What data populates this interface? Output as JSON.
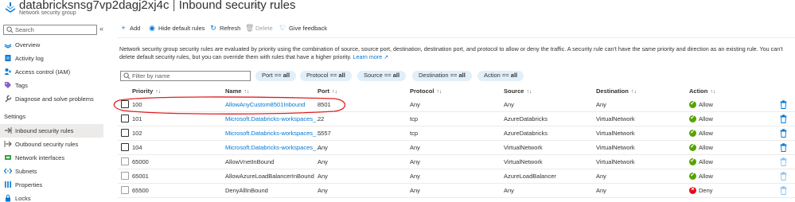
{
  "header": {
    "resource_name": "databricksnsg7vp2dagj2xj4c",
    "page_name": "Inbound security rules",
    "separator": "|",
    "resource_type": "Network security group",
    "star_glyph": "☆",
    "more_glyph": "···"
  },
  "sidebar": {
    "search_placeholder": "Search",
    "collapse_glyph": "«",
    "items_top": [
      {
        "label": "Overview",
        "icon": "overview-icon"
      },
      {
        "label": "Activity log",
        "icon": "activity-log-icon"
      },
      {
        "label": "Access control (IAM)",
        "icon": "iam-icon"
      },
      {
        "label": "Tags",
        "icon": "tag-icon"
      },
      {
        "label": "Diagnose and solve problems",
        "icon": "wrench-icon"
      }
    ],
    "section_settings": "Settings",
    "items_settings": [
      {
        "label": "Inbound security rules",
        "icon": "inbound-icon",
        "active": true
      },
      {
        "label": "Outbound security rules",
        "icon": "outbound-icon"
      },
      {
        "label": "Network interfaces",
        "icon": "nic-icon"
      },
      {
        "label": "Subnets",
        "icon": "subnet-icon"
      },
      {
        "label": "Properties",
        "icon": "properties-icon"
      },
      {
        "label": "Locks",
        "icon": "lock-icon"
      }
    ]
  },
  "toolbar": {
    "add": "Add",
    "hide_default": "Hide default rules",
    "refresh": "Refresh",
    "delete": "Delete",
    "feedback": "Give feedback"
  },
  "description": {
    "text": "Network security group security rules are evaluated by priority using the combination of source, source port, destination, destination port, and protocol to allow or deny the traffic. A security rule can't have the same priority and direction as an existing rule. You can't delete default security rules, but you can override them with rules that have a higher priority.",
    "learn_more": "Learn more"
  },
  "filters": {
    "name_placeholder": "Filter by name",
    "pills": [
      {
        "label": "Port == ",
        "value": "all"
      },
      {
        "label": "Protocol == ",
        "value": "all"
      },
      {
        "label": "Source == ",
        "value": "all"
      },
      {
        "label": "Destination == ",
        "value": "all"
      },
      {
        "label": "Action == ",
        "value": "all"
      }
    ]
  },
  "table": {
    "columns": [
      "Priority",
      "Name",
      "Port",
      "Protocol",
      "Source",
      "Destination",
      "Action"
    ],
    "sort_glyph": "↑↓",
    "rows": [
      {
        "priority": "100",
        "name": "AllowAnyCustom8501Inbound",
        "port": "8501",
        "protocol": "Any",
        "source": "Any",
        "destination": "Any",
        "action": "Allow",
        "default": false
      },
      {
        "priority": "101",
        "name": "Microsoft.Databricks-workspaces_...",
        "port": "22",
        "protocol": "tcp",
        "source": "AzureDatabricks",
        "destination": "VirtualNetwork",
        "action": "Allow",
        "default": false
      },
      {
        "priority": "102",
        "name": "Microsoft.Databricks-workspaces_...",
        "port": "5557",
        "protocol": "tcp",
        "source": "AzureDatabricks",
        "destination": "VirtualNetwork",
        "action": "Allow",
        "default": false
      },
      {
        "priority": "104",
        "name": "Microsoft.Databricks-workspaces_...",
        "port": "Any",
        "protocol": "Any",
        "source": "VirtualNetwork",
        "destination": "VirtualNetwork",
        "action": "Allow",
        "default": false
      },
      {
        "priority": "65000",
        "name": "AllowVnetInBound",
        "port": "Any",
        "protocol": "Any",
        "source": "VirtualNetwork",
        "destination": "VirtualNetwork",
        "action": "Allow",
        "default": true
      },
      {
        "priority": "65001",
        "name": "AllowAzureLoadBalancerInBound",
        "port": "Any",
        "protocol": "Any",
        "source": "AzureLoadBalancer",
        "destination": "Any",
        "action": "Allow",
        "default": true
      },
      {
        "priority": "65500",
        "name": "DenyAllInBound",
        "port": "Any",
        "protocol": "Any",
        "source": "Any",
        "destination": "Any",
        "action": "Deny",
        "default": true
      }
    ]
  },
  "colors": {
    "accent": "#0078d4",
    "allow": "#57a300",
    "deny": "#e00b1c",
    "annotation": "#e02020"
  }
}
